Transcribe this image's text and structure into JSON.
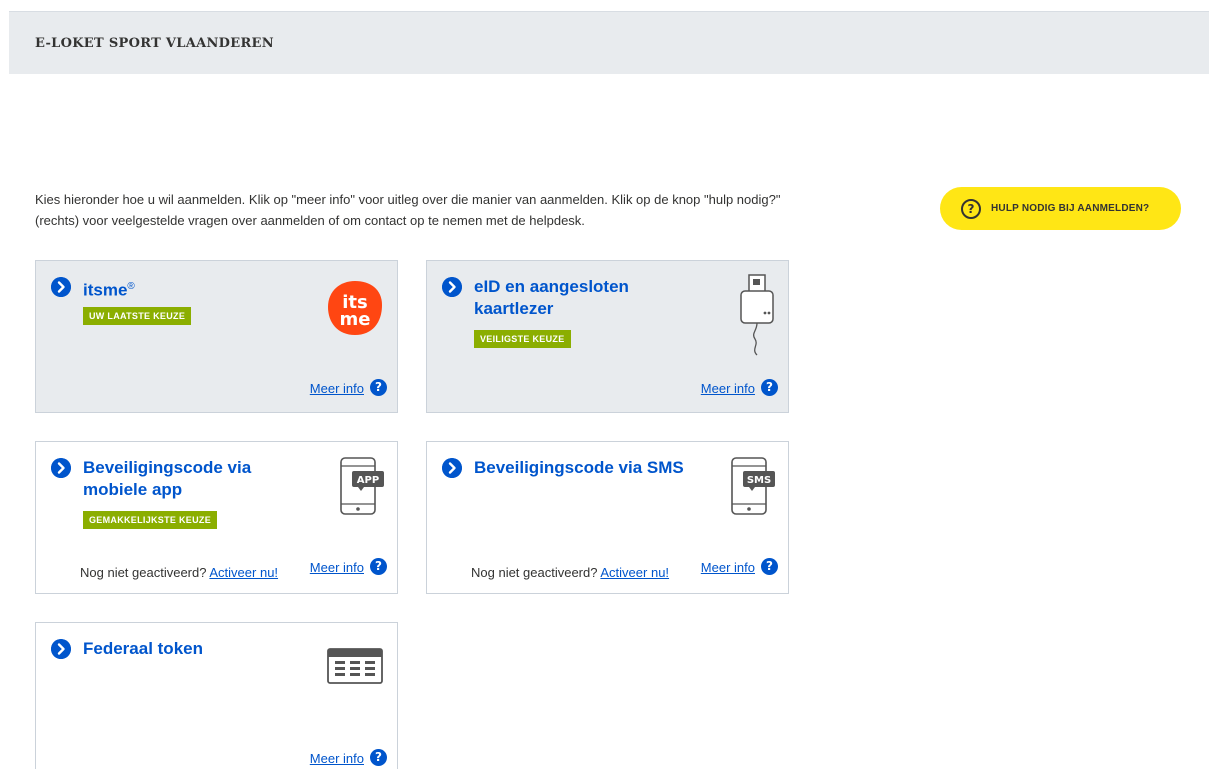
{
  "header": {
    "title": "E-LOKET SPORT VLAANDEREN"
  },
  "intro": {
    "text": "Kies hieronder hoe u wil aanmelden. Klik op \"meer info\" voor uitleg over die manier van aanmelden. Klik op de knop \"hulp nodig?\" (rechts) voor veelgestelde vragen over aanmelden of om contact op te nemen met de helpdesk."
  },
  "help": {
    "icon_symbol": "?",
    "label": "HULP NODIG BIJ AANMELDEN?",
    "icon": "question-circle-icon"
  },
  "colors": {
    "accent_blue": "#0055cc",
    "badge_green": "#8bae00",
    "help_yellow": "#ffe615",
    "itsme_orange": "#ff4612",
    "header_gray": "#e8ebee"
  },
  "methods": [
    {
      "title": "itsme",
      "title_sup": "®",
      "badge": "UW LAATSTE KEUZE",
      "icon": "itsme-logo",
      "logo_line1": "its",
      "logo_line2": "me",
      "meer_info": "Meer info",
      "help_symbol": "?"
    },
    {
      "title": "eID en aangesloten kaartlezer",
      "badge": "VEILIGSTE KEUZE",
      "icon": "card-reader-icon",
      "meer_info": "Meer info",
      "help_symbol": "?"
    },
    {
      "title": "Beveiligingscode via mobiele app",
      "badge": "GEMAKKELIJKSTE KEUZE",
      "icon": "phone-app-icon",
      "icon_label": "APP",
      "not_activated": "Nog niet geactiveerd?",
      "activate_link": "Activeer nu!",
      "meer_info": "Meer info",
      "help_symbol": "?"
    },
    {
      "title": "Beveiligingscode via SMS",
      "icon": "phone-sms-icon",
      "icon_label": "SMS",
      "not_activated": "Nog niet geactiveerd?",
      "activate_link": "Activeer nu!",
      "meer_info": "Meer info",
      "help_symbol": "?"
    },
    {
      "title": "Federaal token",
      "icon": "token-card-icon",
      "meer_info": "Meer info",
      "help_symbol": "?"
    }
  ]
}
